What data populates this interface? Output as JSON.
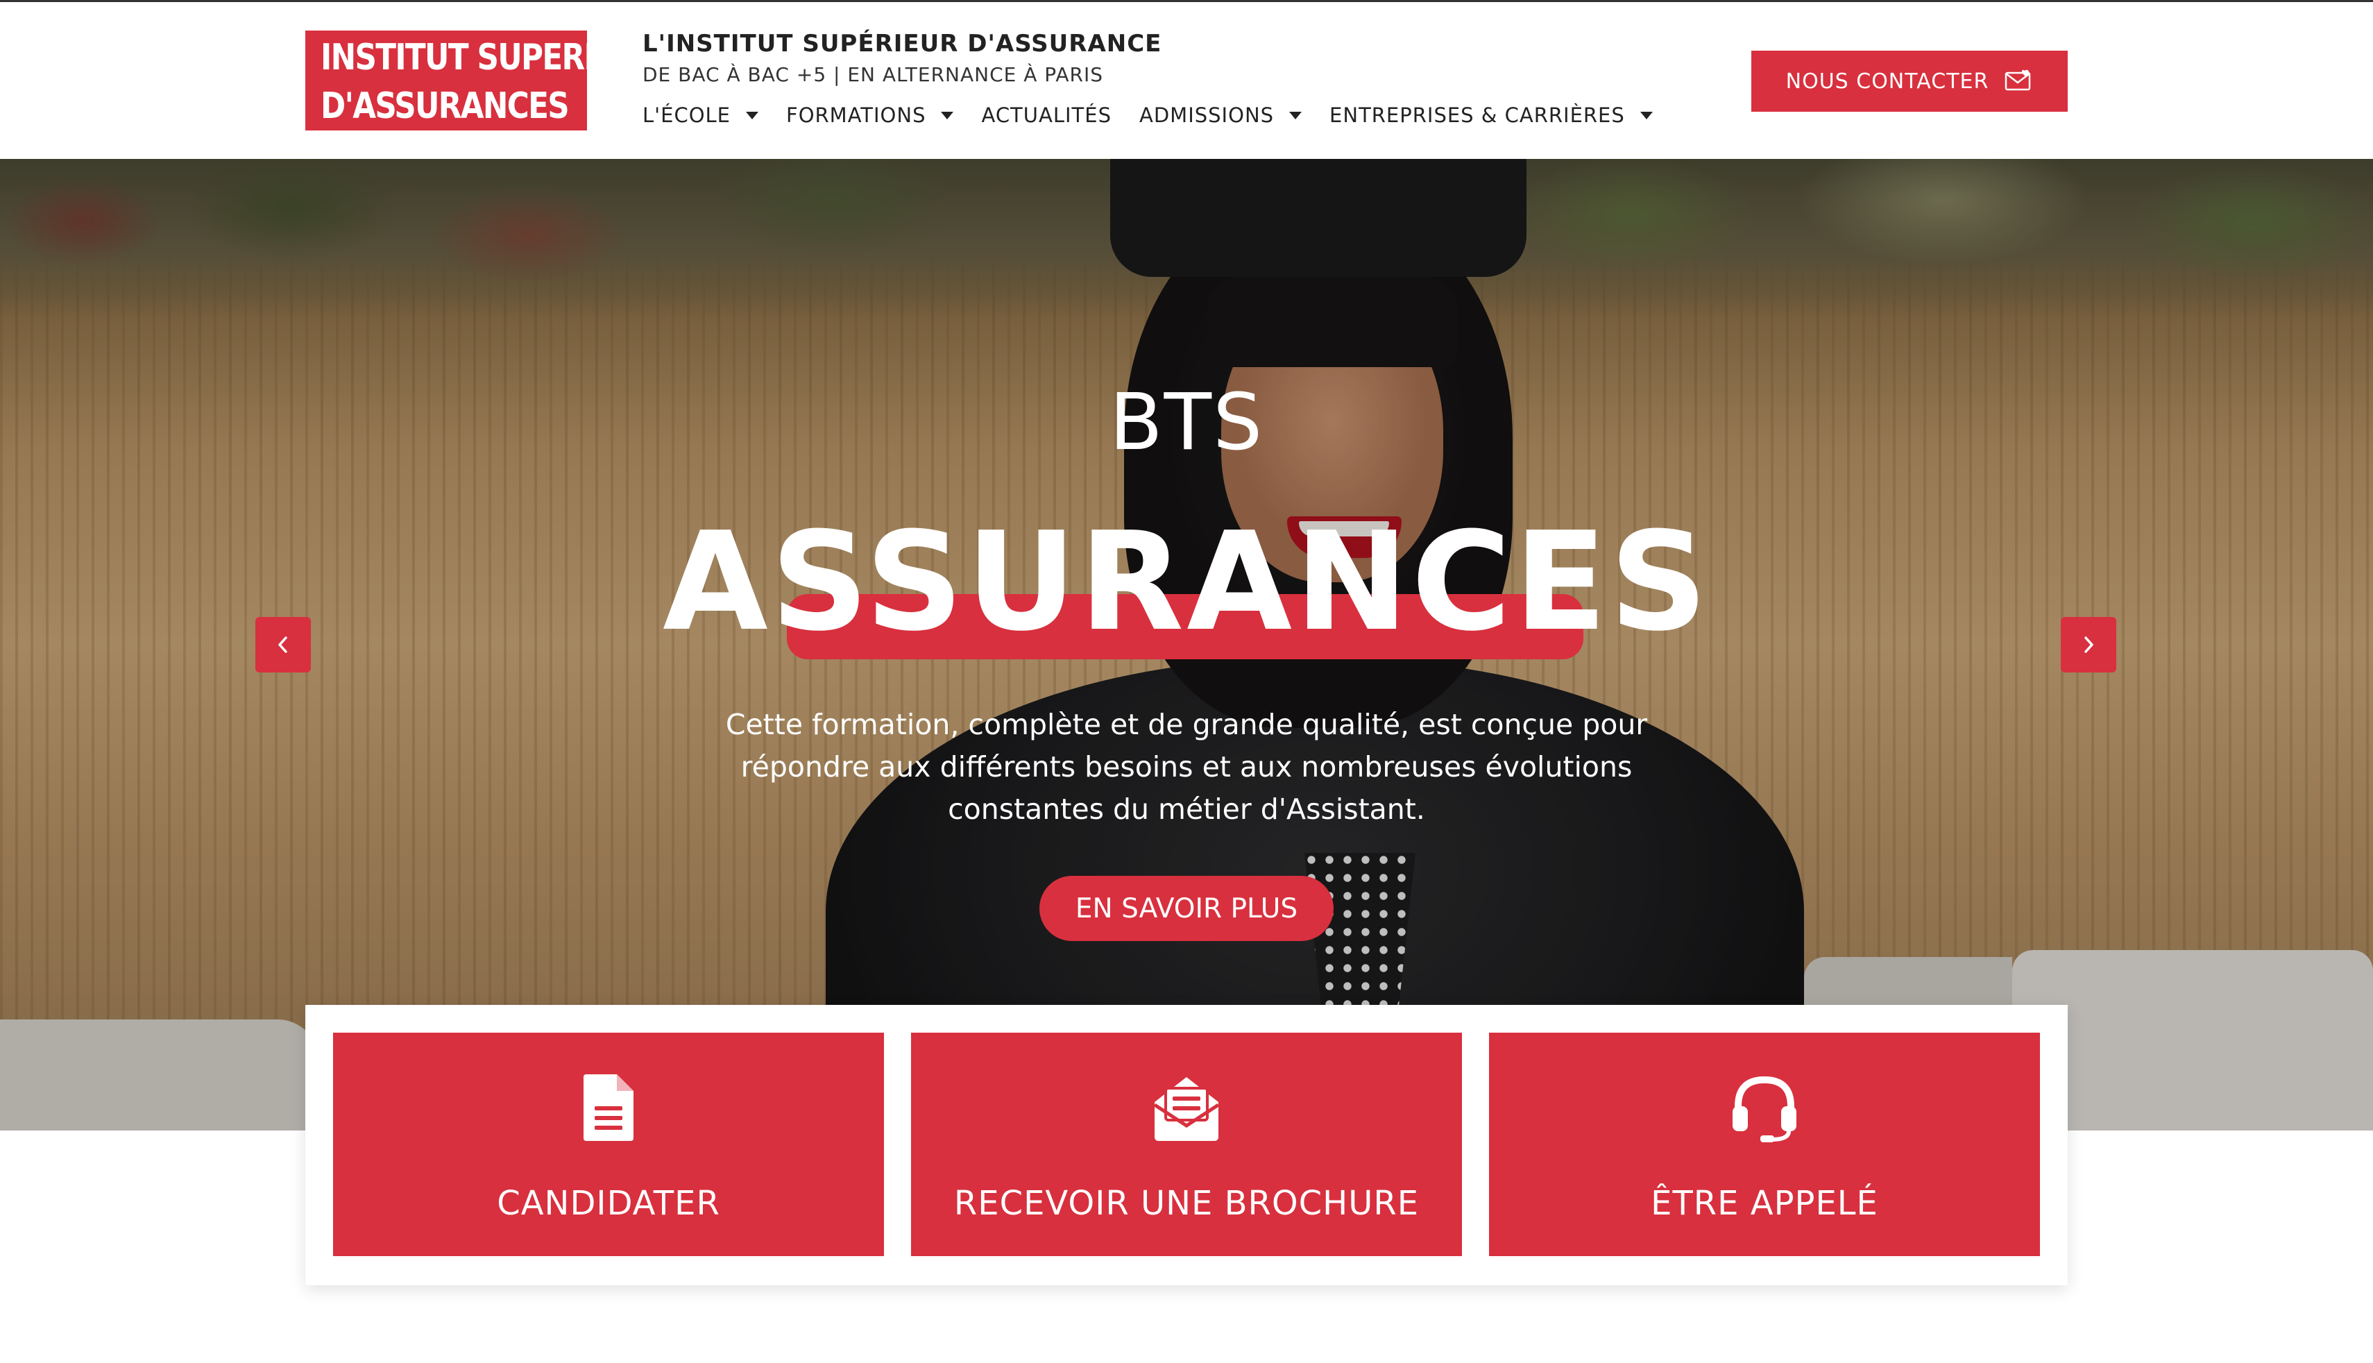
{
  "header": {
    "logo_line1": "INSTITUT SUPERIEUR",
    "logo_line2": "D'ASSURANCES",
    "title": "L'INSTITUT SUPÉRIEUR D'ASSURANCE",
    "subtitle": "DE BAC À BAC +5 | EN ALTERNANCE À PARIS",
    "nav": [
      {
        "label": "L'ÉCOLE",
        "dropdown": true
      },
      {
        "label": "FORMATIONS",
        "dropdown": true
      },
      {
        "label": "ACTUALITÉS",
        "dropdown": false
      },
      {
        "label": "ADMISSIONS",
        "dropdown": true
      },
      {
        "label": "ENTREPRISES & CARRIÈRES",
        "dropdown": true
      }
    ],
    "contact_label": "NOUS CONTACTER",
    "contact_icon": "envelope-heart-icon"
  },
  "hero": {
    "overline": "BTS",
    "title": "ASSURANCES",
    "text": "Cette formation, complète et de grande qualité, est conçue pour répondre aux différents besoins et aux nombreuses évolutions constantes du métier d'Assistant.",
    "cta_label": "EN SAVOIR PLUS",
    "prev_icon": "chevron-left-icon",
    "next_icon": "chevron-right-icon"
  },
  "actions": [
    {
      "label": "CANDIDATER",
      "icon": "document-icon"
    },
    {
      "label": "RECEVOIR UNE BROCHURE",
      "icon": "envelope-open-icon"
    },
    {
      "label": "ÊTRE APPELÉ",
      "icon": "headset-icon"
    }
  ],
  "colors": {
    "accent": "#d8303e",
    "text": "#222222",
    "white": "#ffffff"
  }
}
